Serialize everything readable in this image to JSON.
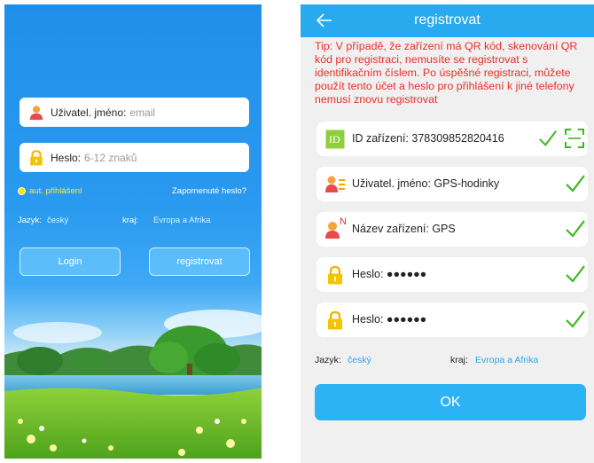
{
  "login": {
    "username_label": "Uživatel. jméno:",
    "username_placeholder": "email",
    "password_label": "Heslo:",
    "password_placeholder": "6-12 znaků",
    "auto_login": "aut. přihlášení",
    "forgot_password": "Zapomenuté heslo?",
    "language_label": "Jazyk:",
    "language_value": "český",
    "region_label": "kraj:",
    "region_value": "Evropa a Afrika",
    "login_button": "Login",
    "register_button": "registrovat"
  },
  "register": {
    "title": "registrovat",
    "tip": "Tip: V případě, že zařízení má QR kód, skenování QR kód pro registraci, nemusíte se registrovat s identifikačním číslem. Po úspěšné registraci, můžete použít tento účet a heslo pro přihlášení k jiné telefony nemusí znovu registrovat",
    "fields": [
      {
        "label": "ID zařízení:",
        "value": "378309852820416",
        "icon": "id-icon"
      },
      {
        "label": "Uživatel. jméno:",
        "value": "GPS-hodinky",
        "icon": "user-list-icon"
      },
      {
        "label": "Název zařízení:",
        "value": "GPS",
        "icon": "user-n-icon"
      },
      {
        "label": "Heslo:",
        "value": "●●●●●●",
        "icon": "lock-icon"
      },
      {
        "label": "Heslo:",
        "value": "●●●●●●",
        "icon": "lock-icon"
      }
    ],
    "id_badge": "ID",
    "n_badge": "N",
    "language_label": "Jazyk:",
    "language_value": "český",
    "region_label": "kraj:",
    "region_value": "Evropa a Afrika",
    "ok_button": "OK"
  },
  "colors": {
    "accent": "#29a9ee",
    "tip_red": "#e8302a",
    "check_green": "#3cb81e"
  }
}
